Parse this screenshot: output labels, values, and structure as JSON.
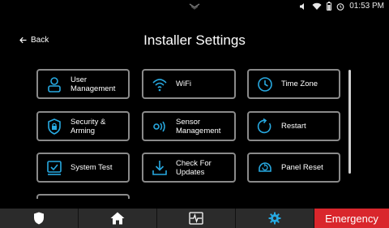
{
  "status_bar": {
    "time": "01:53 PM",
    "icons": [
      "volume-icon",
      "wifi-icon",
      "battery-icon",
      "alarm-clock-icon"
    ]
  },
  "header": {
    "back_label": "Back",
    "title": "Installer Settings"
  },
  "tiles": [
    {
      "label": "User Management",
      "icon": "user-icon"
    },
    {
      "label": "WiFi",
      "icon": "wifi-icon"
    },
    {
      "label": "Time Zone",
      "icon": "clock-icon"
    },
    {
      "label": "Security & Arming",
      "icon": "shield-lock-icon"
    },
    {
      "label": "Sensor Management",
      "icon": "sensor-icon"
    },
    {
      "label": "Restart",
      "icon": "restart-icon"
    },
    {
      "label": "System Test",
      "icon": "system-test-icon"
    },
    {
      "label": "Check For Updates",
      "icon": "download-icon"
    },
    {
      "label": "Panel Reset",
      "icon": "panel-reset-icon"
    }
  ],
  "bottom_nav": {
    "tabs": [
      "shield-icon",
      "home-icon",
      "activity-icon",
      "gear-icon"
    ],
    "emergency_label": "Emergency"
  },
  "colors": {
    "accent": "#27a9e1",
    "tile_border": "#8a8a8a",
    "emergency": "#d9262c",
    "nav_bg": "#2b2b2b"
  }
}
